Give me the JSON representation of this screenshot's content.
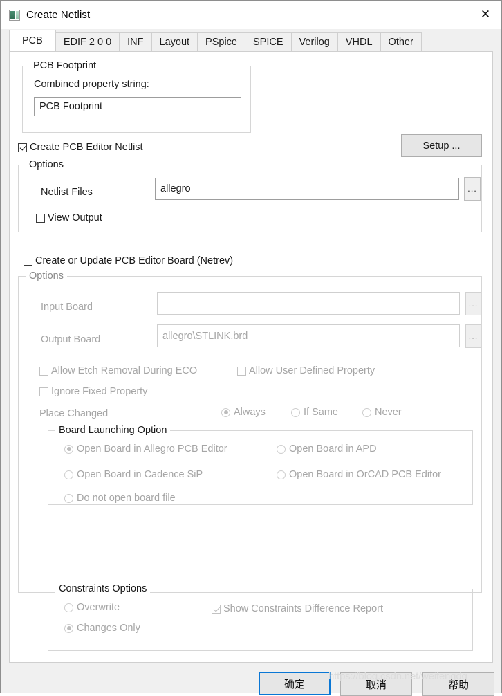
{
  "window": {
    "title": "Create Netlist",
    "icon": "netlist-app-icon",
    "close_icon": "close-icon"
  },
  "tabs": [
    {
      "label": "PCB",
      "active": true
    },
    {
      "label": "EDIF 2 0 0",
      "active": false
    },
    {
      "label": "INF",
      "active": false
    },
    {
      "label": "Layout",
      "active": false
    },
    {
      "label": "PSpice",
      "active": false
    },
    {
      "label": "SPICE",
      "active": false
    },
    {
      "label": "Verilog",
      "active": false
    },
    {
      "label": "VHDL",
      "active": false
    },
    {
      "label": "Other",
      "active": false
    }
  ],
  "pcb_footprint": {
    "legend": "PCB Footprint",
    "combined_label": "Combined property string:",
    "combined_value": "PCB Footprint"
  },
  "create_netlist": {
    "checkbox_label": "Create PCB Editor Netlist",
    "checked": true,
    "setup_button": "Setup ..."
  },
  "netlist_options": {
    "legend": "Options",
    "netlist_files_label": "Netlist Files",
    "netlist_files_value": "allegro",
    "browse_label": "...",
    "view_output_label": "View Output",
    "view_output_checked": false
  },
  "netrev": {
    "checkbox_label": "Create or Update PCB Editor Board (Netrev)",
    "checked": false
  },
  "board_options": {
    "legend": "Options",
    "input_board_label": "Input Board",
    "input_board_value": "",
    "output_board_label": "Output Board",
    "output_board_value": "allegro\\STLINK.brd",
    "browse_label": "...",
    "allow_etch_label": "Allow Etch Removal During ECO",
    "allow_etch_checked": false,
    "allow_user_prop_label": "Allow User Defined Property",
    "allow_user_prop_checked": false,
    "ignore_fixed_label": "Ignore Fixed Property",
    "ignore_fixed_checked": false,
    "place_changed_label": "Place Changed",
    "place_changed_options": [
      {
        "label": "Always",
        "selected": true
      },
      {
        "label": "If Same",
        "selected": false
      },
      {
        "label": "Never",
        "selected": false
      }
    ]
  },
  "board_launching": {
    "legend": "Board Launching Option",
    "options": [
      {
        "label": "Open Board in Allegro PCB Editor",
        "selected": true
      },
      {
        "label": "Open Board in APD",
        "selected": false
      },
      {
        "label": "Open Board in Cadence SiP",
        "selected": false
      },
      {
        "label": "Open Board in OrCAD PCB Editor",
        "selected": false
      },
      {
        "label": "Do not open board file",
        "selected": false
      }
    ]
  },
  "constraints": {
    "legend": "Constraints Options",
    "options": [
      {
        "label": "Overwrite",
        "selected": false
      },
      {
        "label": "Changes  Only",
        "selected": true
      }
    ],
    "show_report_label": "Show Constraints Difference Report",
    "show_report_checked": true
  },
  "footer": {
    "ok": "确定",
    "cancel": "取消",
    "help": "帮助",
    "watermark": "https://blog.csdn.net/weifengdq"
  }
}
